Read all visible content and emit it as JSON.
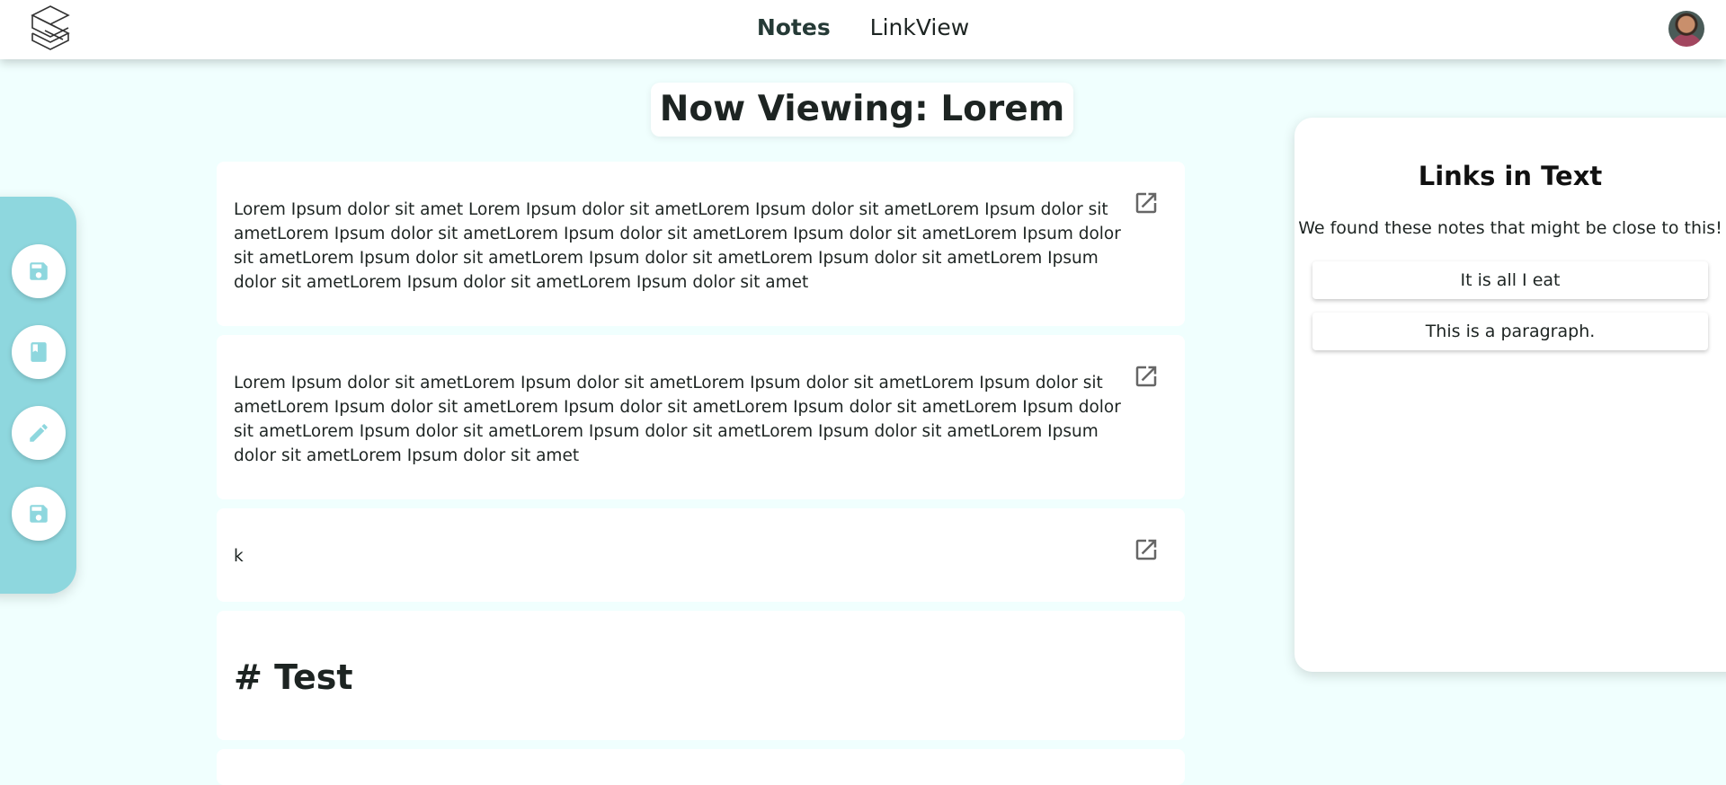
{
  "nav": {
    "items": [
      {
        "label": "Notes",
        "active": true
      },
      {
        "label": "LinkView",
        "active": false
      }
    ]
  },
  "page": {
    "title": "Now Viewing: Lorem"
  },
  "toolbar": {
    "buttons": [
      {
        "icon": "save-icon"
      },
      {
        "icon": "book-icon"
      },
      {
        "icon": "pencil-icon"
      },
      {
        "icon": "save-icon"
      }
    ],
    "accent_color": "#8ed7de"
  },
  "notes": [
    {
      "text": "Lorem Ipsum dolor sit amet Lorem Ipsum dolor sit ametLorem Ipsum dolor sit ametLorem Ipsum dolor sit ametLorem Ipsum dolor sit ametLorem Ipsum dolor sit ametLorem Ipsum dolor sit ametLorem Ipsum dolor sit ametLorem Ipsum dolor sit ametLorem Ipsum dolor sit ametLorem Ipsum dolor sit ametLorem Ipsum dolor sit ametLorem Ipsum dolor sit ametLorem Ipsum dolor sit amet"
    },
    {
      "text": "Lorem Ipsum dolor sit ametLorem Ipsum dolor sit ametLorem Ipsum dolor sit ametLorem Ipsum dolor sit ametLorem Ipsum dolor sit ametLorem Ipsum dolor sit ametLorem Ipsum dolor sit ametLorem Ipsum dolor sit ametLorem Ipsum dolor sit ametLorem Ipsum dolor sit ametLorem Ipsum dolor sit ametLorem Ipsum dolor sit ametLorem Ipsum dolor sit amet"
    },
    {
      "text": "k"
    },
    {
      "heading": "# Test"
    }
  ],
  "links_panel": {
    "title": "Links in Text",
    "subtitle": "We found these notes that might be close to this!",
    "links": [
      "It is all I eat",
      "This is a paragraph."
    ]
  }
}
